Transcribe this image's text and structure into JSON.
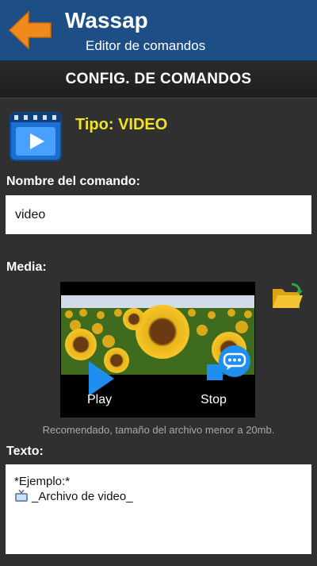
{
  "app_bar": {
    "title": "Wassap",
    "subtitle": "Editor de comandos",
    "back_icon": "arrow-left-icon",
    "color": "#1d4f86",
    "back_color": "#f08a1c"
  },
  "section": {
    "title": "CONFIG. DE COMANDOS"
  },
  "type": {
    "label": "Tipo: VIDEO",
    "icon": "video-file-icon",
    "color": "#f2e227"
  },
  "name": {
    "label": "Nombre del comando:",
    "value": "video"
  },
  "media": {
    "label": "Media:",
    "thumbnail": "sunflower-field-image",
    "play_label": "Play",
    "stop_label": "Stop",
    "folder_icon": "folder-open-icon",
    "chat_icon": "chat-bubble-icon",
    "hint": "Recomendado, tamaño del archivo menor a 20mb."
  },
  "text": {
    "label": "Texto:",
    "line1": "*Ejemplo:*",
    "line2": "_Archivo de video_",
    "line2_icon": "tv-icon"
  }
}
